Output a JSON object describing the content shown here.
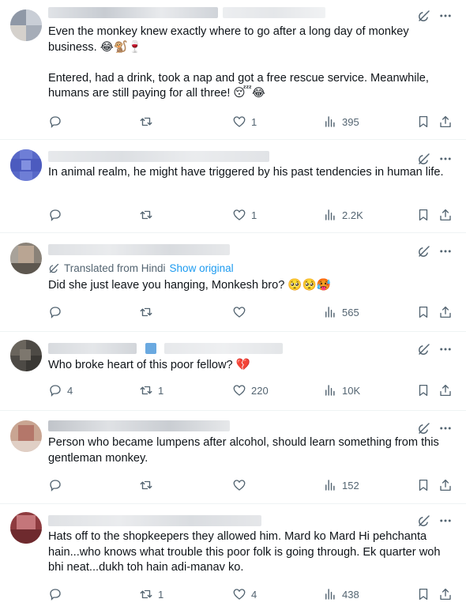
{
  "tweets": [
    {
      "body": "Even the monkey knew exactly where to go after a long day of monkey business. 😂🐒🍷\n\nEntered, had a drink, took a nap and got a free rescue service. Meanwhile, humans are still paying for all three! 😴😂",
      "replies": "",
      "reposts": "",
      "likes": "1",
      "views": "395"
    },
    {
      "body": "In animal realm, he might have triggered by his past tendencies in human life.",
      "replies": "",
      "reposts": "",
      "likes": "1",
      "views": "2.2K"
    },
    {
      "translated_label": "Translated from Hindi",
      "show_original": "Show original",
      "body": "Did she just leave you hanging, Monkesh bro? 🥺🥺🥵",
      "replies": "",
      "reposts": "",
      "likes": "",
      "views": "565"
    },
    {
      "body": "Who broke heart of this poor fellow? 💔",
      "replies": "4",
      "reposts": "1",
      "likes": "220",
      "views": "10K"
    },
    {
      "body": "Person who became lumpens after alcohol, should learn something from this gentleman monkey.",
      "replies": "",
      "reposts": "",
      "likes": "",
      "views": "152"
    },
    {
      "body": "Hats off to the shopkeepers they allowed him. Mard ko Mard Hi pehchanta hain...who knows what trouble this poor folk is going through. Ek quarter woh bhi neat...dukh toh hain adi-manav ko.",
      "replies": "",
      "reposts": "1",
      "likes": "4",
      "views": "438"
    }
  ],
  "icons": {
    "reply": "reply-icon",
    "repost": "repost-icon",
    "like": "heart-icon",
    "views": "views-icon",
    "bookmark": "bookmark-icon",
    "share": "share-icon",
    "grok": "grok-icon",
    "more": "more-icon"
  },
  "colors": {
    "text": "#0f1419",
    "muted": "#536471",
    "link": "#1d9bf0",
    "divider": "#eff3f4"
  }
}
